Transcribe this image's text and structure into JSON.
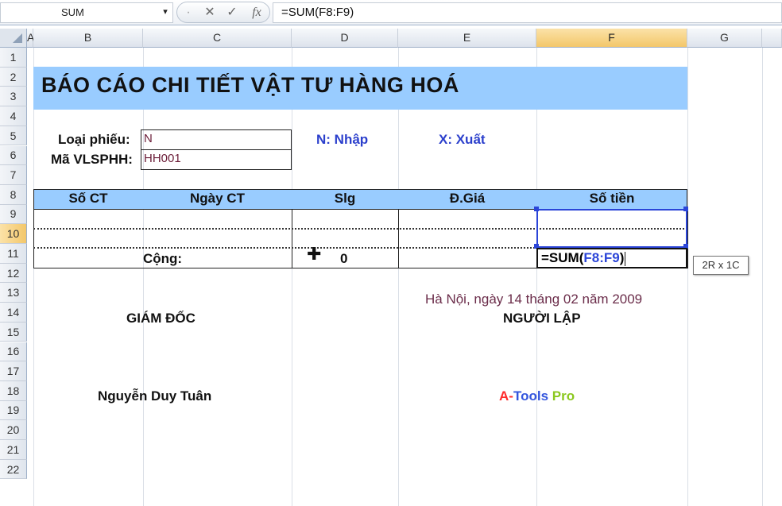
{
  "formula_bar": {
    "name_box": "SUM",
    "name_dropdown_icon": "▾",
    "cancel_icon": "✕",
    "enter_icon": "✓",
    "fx_icon": "fx",
    "formula": "=SUM(F8:F9)"
  },
  "columns": [
    "A",
    "B",
    "C",
    "D",
    "E",
    "F",
    "G"
  ],
  "rows": [
    "1",
    "2",
    "3",
    "4",
    "5",
    "6",
    "7",
    "8",
    "9",
    "10",
    "11",
    "12",
    "13",
    "14",
    "15",
    "16",
    "17",
    "18",
    "19",
    "20",
    "21",
    "22"
  ],
  "selected_column": "F",
  "selected_row": "10",
  "sheet": {
    "title": "BÁO CÁO CHI TIẾT VẬT TƯ HÀNG HOÁ",
    "loai_phieu_label": "Loại phiếu:",
    "loai_phieu_value": "N",
    "ma_label": "Mã VLSPHH:",
    "ma_value": "HH001",
    "legend_nhap": "N: Nhập",
    "legend_xuat": "X: Xuất",
    "table_headers": [
      "Số CT",
      "Ngày CT",
      "Slg",
      "Đ.Giá",
      "Số tiền"
    ],
    "total_label": "Cộng:",
    "total_qty": "0",
    "edit_formula_prefix": "=SUM(",
    "edit_formula_ref": "F8:F9",
    "edit_formula_suffix": ")",
    "range_tooltip": "2R x 1C",
    "date_line": "Hà Nội, ngày 14 tháng 02 năm 2009",
    "sign_left_title": "GIÁM ĐỐC",
    "sign_right_title": "NGƯỜI LẬP",
    "sign_left_name": "Nguyễn Duy Tuân",
    "brand_part1": "A-",
    "brand_part2": "Tools",
    "brand_part3": " Pro"
  },
  "colors": {
    "title_fill": "#99ccff",
    "header_fill": "#99ccff",
    "legend_blue": "#2b3fcc",
    "selection_blue": "#2b45d8",
    "brand_red": "#ff2a2a",
    "brand_blue": "#3355dd",
    "brand_green": "#8bc81e"
  }
}
